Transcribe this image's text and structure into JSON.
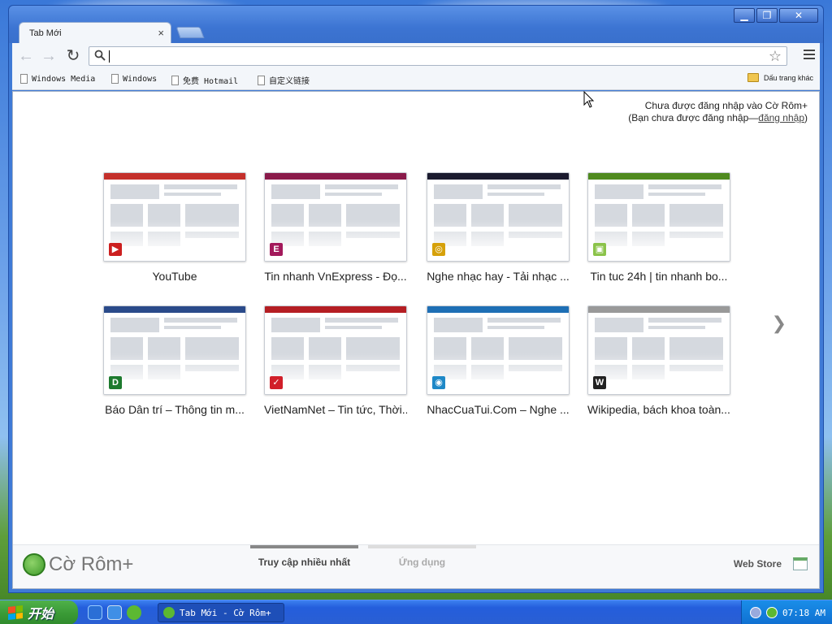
{
  "window": {
    "tab_title": "Tab Mới",
    "tab_close": "×",
    "controls": [
      "▁",
      "❐",
      "✕"
    ]
  },
  "toolbar": {
    "back": "←",
    "forward": "→",
    "reload": "↻",
    "search_icon": "search-icon",
    "omnibox_value": "",
    "star": "☆"
  },
  "bookmarks": {
    "items": [
      {
        "label": "Windows Media"
      },
      {
        "label": "Windows"
      },
      {
        "label": "免费 Hotmail"
      },
      {
        "label": "自定义链接"
      }
    ],
    "other": "Dấu trang khác"
  },
  "signin": {
    "line1": "Chưa được đăng nhập vào Cờ Rôm+",
    "line2_prefix": "(Bạn chưa được đăng nhập—",
    "line2_link": "đăng nhập",
    "line2_suffix": ")"
  },
  "tiles": [
    {
      "title": "YouTube",
      "favicon": "▶",
      "favicon_color": "#cc1f1f",
      "accent": "#c4302b"
    },
    {
      "title": "Tin nhanh VnExpress - Đọ...",
      "favicon": "E",
      "favicon_color": "#a3195b",
      "accent": "#8a1a4a"
    },
    {
      "title": "Nghe nhạc hay - Tải nhạc ...",
      "favicon": "◎",
      "favicon_color": "#d6a10a",
      "accent": "#1a1a2e"
    },
    {
      "title": "Tin tuc 24h | tin nhanh bo...",
      "favicon": "▣",
      "favicon_color": "#8bc34a",
      "accent": "#4f8a1f"
    },
    {
      "title": "Báo Dân trí – Thông tin m...",
      "favicon": "D",
      "favicon_color": "#1d7a2e",
      "accent": "#2a4a8a"
    },
    {
      "title": "VietNamNet – Tin tức, Thời...",
      "favicon": "✓",
      "favicon_color": "#d11f2a",
      "accent": "#b51e23"
    },
    {
      "title": "NhacCuaTui.Com – Nghe ...",
      "favicon": "◉",
      "favicon_color": "#1e88c7",
      "accent": "#1e6fb5"
    },
    {
      "title": "Wikipedia, bách khoa toàn...",
      "favicon": "W",
      "favicon_color": "#222222",
      "accent": "#999999"
    }
  ],
  "next_arrow": "❯",
  "footer": {
    "brand": "Cờ Rôm+",
    "tabs": [
      {
        "label": "Truy cập nhiều nhất",
        "active": true
      },
      {
        "label": "Ứng dụng",
        "active": false
      }
    ],
    "webstore": "Web Store"
  },
  "taskbar": {
    "start": "开始",
    "task_item": "Tab Mới - Cờ Rôm+",
    "clock": "07:18 AM"
  }
}
